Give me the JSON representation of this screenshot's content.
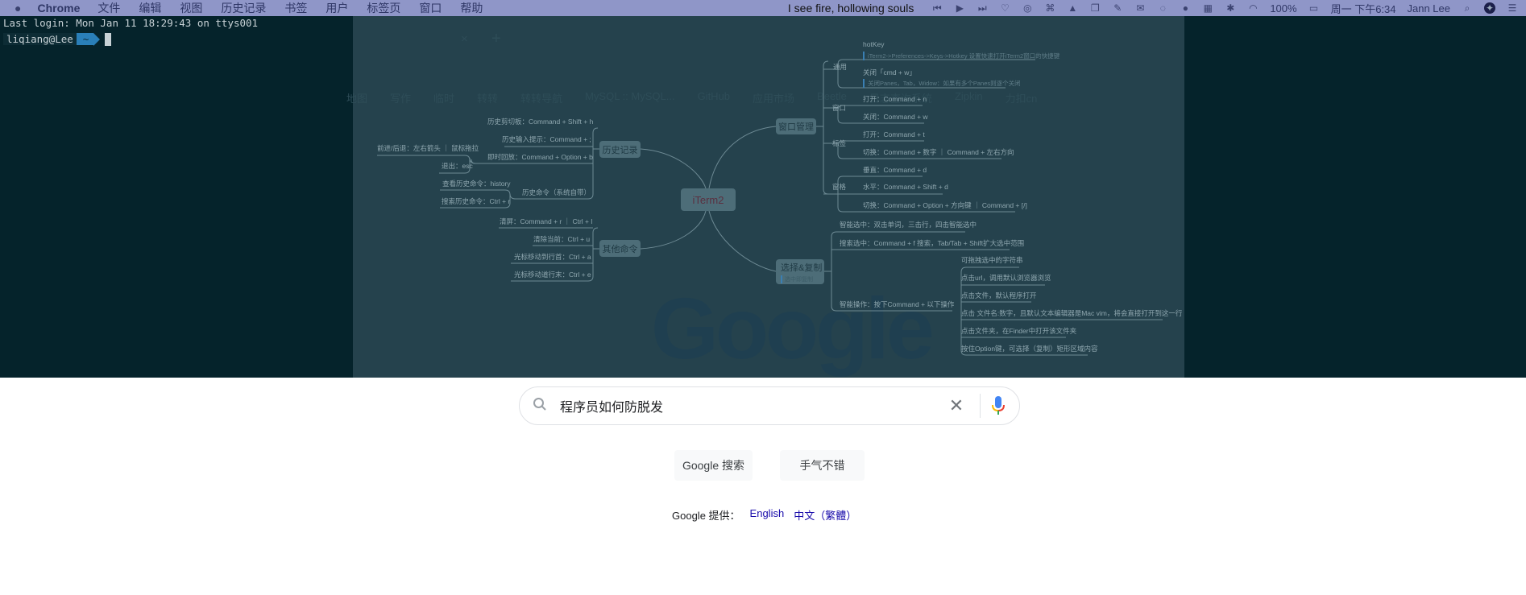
{
  "menubar": {
    "app": "Chrome",
    "items": [
      "文件",
      "编辑",
      "视图",
      "历史记录",
      "书签",
      "用户",
      "标签页",
      "窗口",
      "帮助"
    ],
    "now_playing": "I see fire, hollowing souls",
    "battery": "100%",
    "clock": "周一 下午6:34",
    "user": "Jann Lee"
  },
  "terminal": {
    "last_login": "Last login: Mon Jan 11 18:29:43 on ttys001",
    "user": "liqiang@Lee",
    "dir": "~"
  },
  "browser_bg": {
    "bookmarks": [
      "地图",
      "写作",
      "临时",
      "转转",
      "转转导航",
      "MySQL :: MySQL...",
      "GitHub",
      "应用市场",
      "Beetle",
      "日志查询系统",
      "Zipkin",
      "力扣cn"
    ]
  },
  "mindmap": {
    "root": "iTerm2",
    "history": {
      "label": "历史记录",
      "items": [
        "历史剪切板：Command + Shift + h",
        "历史输入提示：Command + ;",
        "即时回放：Command + Option + b",
        "前进/后退：左右箭头 ｜ 鼠标拖拉",
        "退出：esc",
        "历史命令（系统自带）",
        "查看历史命令：history",
        "搜索历史命令：Ctrl + r"
      ]
    },
    "other": {
      "label": "其他命令",
      "items": [
        "清屏：Command + r ｜ Ctrl + l",
        "清除当前：Ctrl + u",
        "光标移动到行首：Ctrl + a",
        "光标移动道行末：Ctrl + e"
      ]
    },
    "window": {
      "label": "窗口管理",
      "groups": [
        "通用",
        "窗口",
        "标签",
        "窗格"
      ],
      "items": [
        "hotKey",
        "iTerm2->Preferences->Keys->Hotkey 设置快速打开iTerm2窗口的快捷键",
        "关闭「cmd + w」",
        "关闭Panes，Tab，Widow：如果有多个Panes则逐个关闭",
        "打开：Command + n",
        "关闭：Command + w",
        "打开：Command + t",
        "切换：Command + 数字 ｜ Command + 左右方向",
        "垂直：Command + d",
        "水平：Command + Shift + d",
        "切换：Command + Option + 方向键 ｜ Command + [/]"
      ]
    },
    "select": {
      "label": "选择&复制",
      "note": "选中即复制",
      "items": [
        "智能选中：双击单词，三击行，四击智能选中",
        "搜索选中：Command + f 搜索，Tab/Tab + Shift扩大选中范围",
        "智能操作：按下Command + 以下操作"
      ],
      "sub": [
        "可拖拽选中的字符串",
        "点击url，调用默认浏览器浏览",
        "点击文件，默认程序打开",
        "点击 文件名:数字，且默认文本编辑器是Mac vim，将会直接打开到这一行",
        "点击文件夹，在Finder中打开该文件夹",
        "按住Option键，可选择（复制）矩形区域内容"
      ]
    }
  },
  "google": {
    "logo": "Google",
    "query": "程序员如何防脱发",
    "search_btn": "Google 搜索",
    "lucky_btn": "手气不错",
    "offered": "Google 提供：",
    "langs": [
      "English",
      "中文（繁體）"
    ]
  }
}
